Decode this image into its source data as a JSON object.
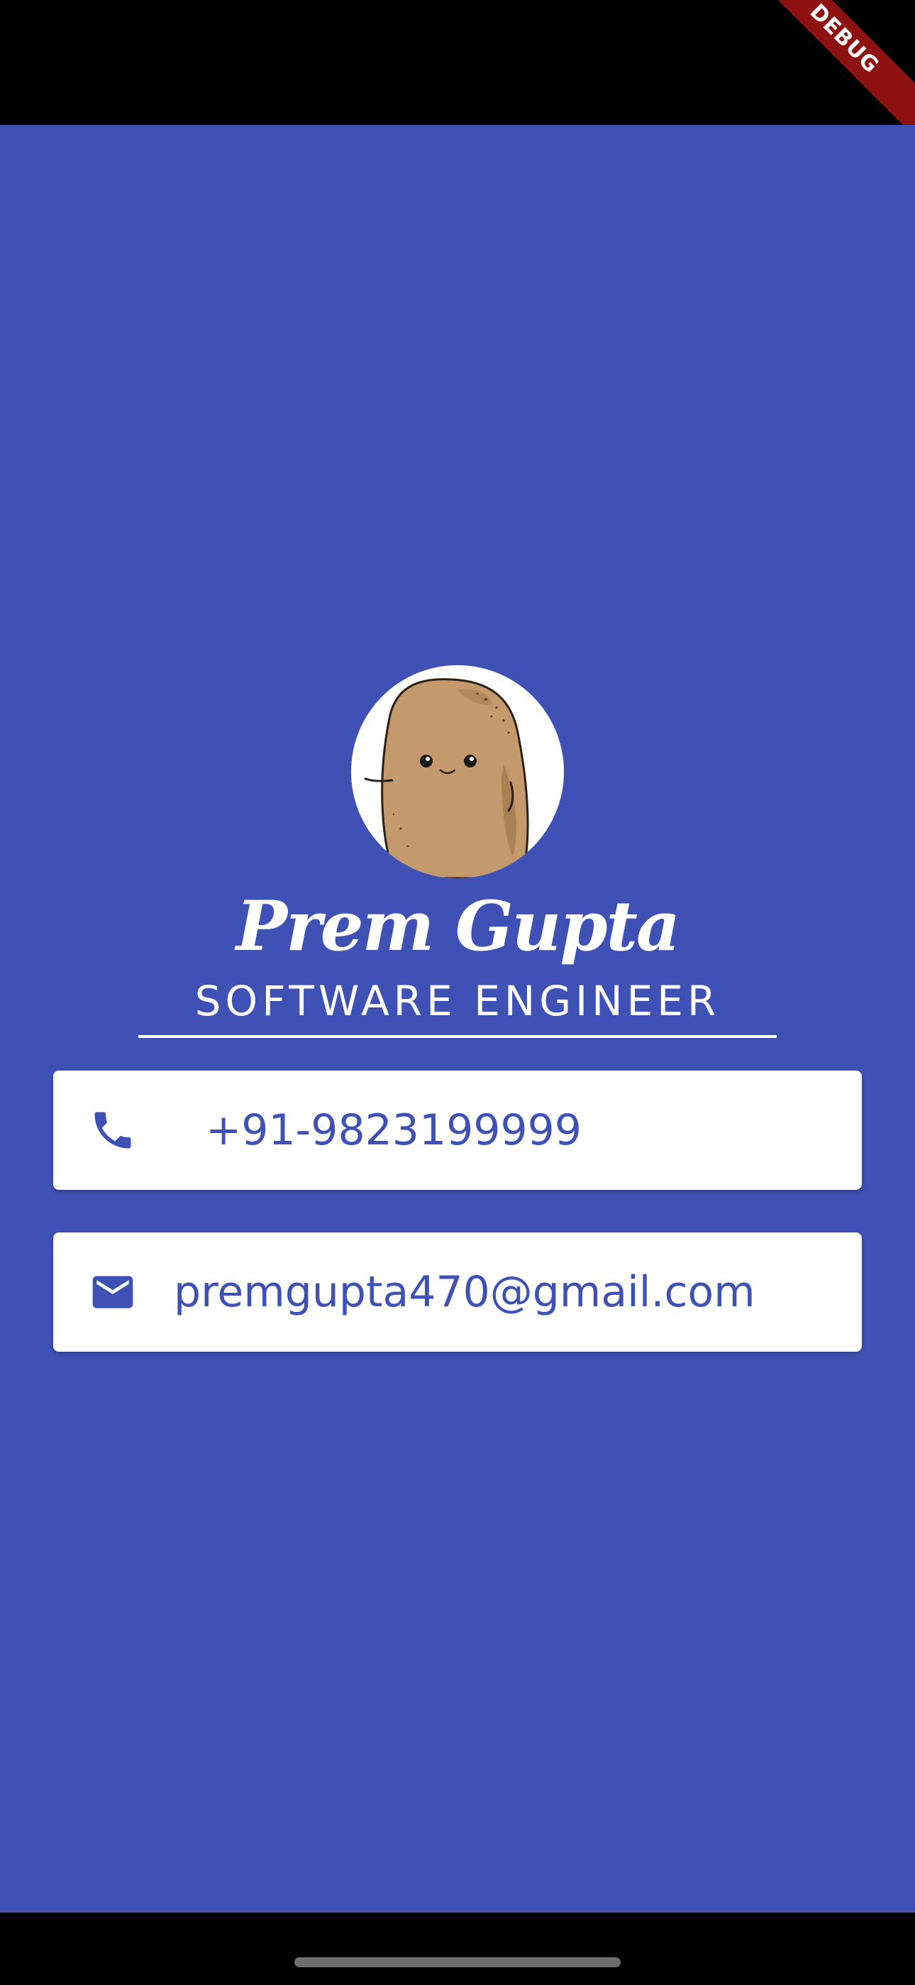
{
  "debug_banner": {
    "label": "DEBUG",
    "color": "#8e1212"
  },
  "profile": {
    "avatar_alt": "potato avatar",
    "name": "Prem Gupta",
    "title": "SOFTWARE ENGINEER"
  },
  "contacts": {
    "phone": {
      "icon": "phone-icon",
      "value": "+91-9823199999"
    },
    "email": {
      "icon": "mail-icon",
      "value": "premgupta470@gmail.com"
    }
  },
  "colors": {
    "background": "#3f51b5",
    "card": "#ffffff",
    "accent_text": "#3f51b5",
    "system_bars": "#000000"
  }
}
